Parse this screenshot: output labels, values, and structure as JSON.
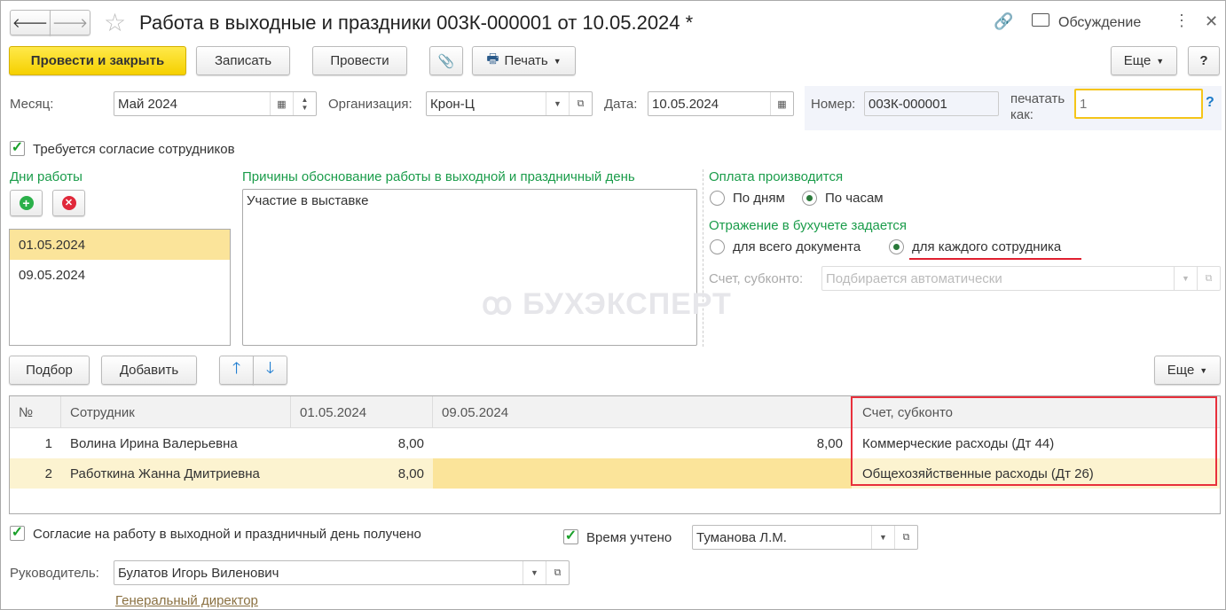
{
  "header": {
    "title": "Работа в выходные и праздники 003К-000001 от 10.05.2024 *",
    "discussion": "Обсуждение"
  },
  "toolbar": {
    "post_close": "Провести и закрыть",
    "save": "Записать",
    "post": "Провести",
    "print": "Печать",
    "more": "Еще",
    "help": "?"
  },
  "fields": {
    "month_label": "Месяц:",
    "month": "Май 2024",
    "org_label": "Организация:",
    "org": "Крон-Ц",
    "date_label": "Дата:",
    "date": "10.05.2024",
    "number_label": "Номер:",
    "number": "003К-000001",
    "print_as_label": "печатать как:",
    "print_as_placeholder": "1",
    "print_as_help": "?"
  },
  "consent_required": "Требуется согласие сотрудников",
  "days": {
    "title": "Дни работы",
    "items": [
      "01.05.2024",
      "09.05.2024"
    ]
  },
  "reason": {
    "title": "Причины обоснование работы в выходной и праздничный день",
    "text": "Участие в выставке"
  },
  "payment": {
    "title": "Оплата производится",
    "by_days": "По дням",
    "by_hours": "По часам",
    "selected": "by_hours"
  },
  "accounting": {
    "title": "Отражение в бухучете задается",
    "whole_doc": "для всего документа",
    "each_employee": "для каждого сотрудника",
    "selected": "each_employee",
    "account_label": "Счет, субконто:",
    "account_placeholder": "Подбирается автоматически"
  },
  "watermark": "БУХЭКСПЕРТ",
  "table_toolbar": {
    "select": "Подбор",
    "add": "Добавить",
    "more": "Еще"
  },
  "table": {
    "headers": [
      "№",
      "Сотрудник",
      "01.05.2024",
      "09.05.2024",
      "Счет, субконто"
    ],
    "rows": [
      [
        "1",
        "Волина Ирина Валерьевна",
        "8,00",
        "8,00",
        "Коммерческие расходы (Дт 44)"
      ],
      [
        "2",
        "Работкина Жанна Дмитриевна",
        "8,00",
        "",
        "Общехозяйственные расходы (Дт 26)"
      ]
    ]
  },
  "footer": {
    "consent_received": "Согласие на работу в выходной и праздничный день получено",
    "time_counted": "Время учтено",
    "time_person": "Туманова Л.М.",
    "manager_label": "Руководитель:",
    "manager": "Булатов Игорь Виленович",
    "manager_position": "Генеральный директор"
  }
}
